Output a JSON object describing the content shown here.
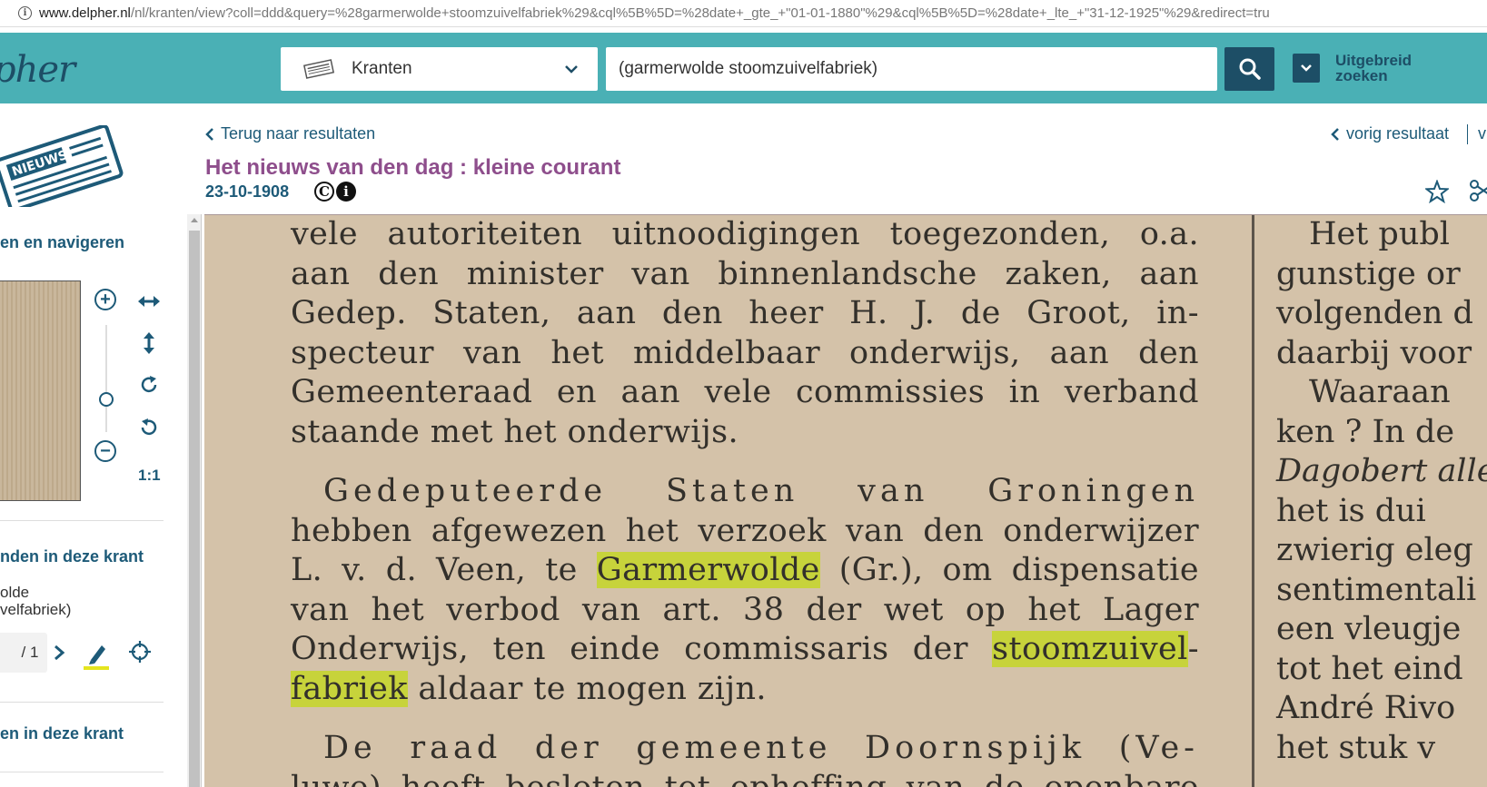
{
  "browser": {
    "url_host": "www.delpher.nl",
    "url_path": "/nl/kranten/view?coll=ddd&query=%28garmerwolde+stoomzuivelfabriek%29&cql%5B%5D=%28date+_gte_+\"01-01-1880\"%29&cql%5B%5D=%28date+_lte_+\"31-12-1925\"%29&redirect=tru"
  },
  "header": {
    "logo_text": "pher",
    "collection_label": "Kranten",
    "search_value": "(garmerwolde stoomzuivelfabriek)",
    "advanced_line1": "Uitgebreid",
    "advanced_line2": "zoeken"
  },
  "sidebar": {
    "section_navigate": "en en navigeren",
    "zoom_one_to_one": "1:1",
    "section_found": "nden in deze krant",
    "found_query_line1": "olde",
    "found_query_line2": "velfabriek)",
    "pager_text": "/ 1",
    "section_bottom": "en in deze krant"
  },
  "doc": {
    "back_label": "Terug naar resultaten",
    "prev_label": "vorig resultaat",
    "next_label": "v",
    "title": "Het nieuws van den dag : kleine courant",
    "date": "23-10-1908"
  },
  "article": {
    "col1": [
      {
        "text": "vele autoriteiten uitnoodigingen toegezonden, o.a."
      },
      {
        "text": "aan den minister van binnenlandsche zaken, aan"
      },
      {
        "text": "Gedep. Staten, aan den heer H. J. de Groot, in-"
      },
      {
        "text": "specteur van het middelbaar onderwijs, aan den"
      },
      {
        "text": "Gemeenteraad en aan vele commissies in verband"
      },
      {
        "text": "staande met het onderwijs."
      },
      {
        "text": "Gedeputeerde Staten van Groningen"
      },
      {
        "text": "hebben afgewezen het verzoek van den onderwijzer"
      },
      {
        "pre": "L. v. d. Veen, te ",
        "hl": "Garmerwolde",
        "post": " (Gr.), om dispensatie"
      },
      {
        "text": "van het verbod van art. 38 der wet op het Lager"
      },
      {
        "pre": "Onderwijs, ten einde commissaris der ",
        "hl": "stoomzuivel",
        "post": "-"
      },
      {
        "hl": "fabriek",
        "post": " aldaar te mogen zijn."
      },
      {
        "text": "De raad der gemeente Doornspijk (Ve-"
      },
      {
        "text": "luwe) heeft besloten tot opheffing van de openbare"
      }
    ],
    "col2": [
      "Het publ",
      "gunstige or",
      "volgenden d",
      "daarbij voor",
      "Waaraan",
      "ken ? In de",
      "Dagobert alle",
      "het is dui",
      "zwierig eleg",
      "sentimentali",
      "een vleugje",
      "tot het eind",
      "André Rivo",
      "het stuk v"
    ]
  }
}
